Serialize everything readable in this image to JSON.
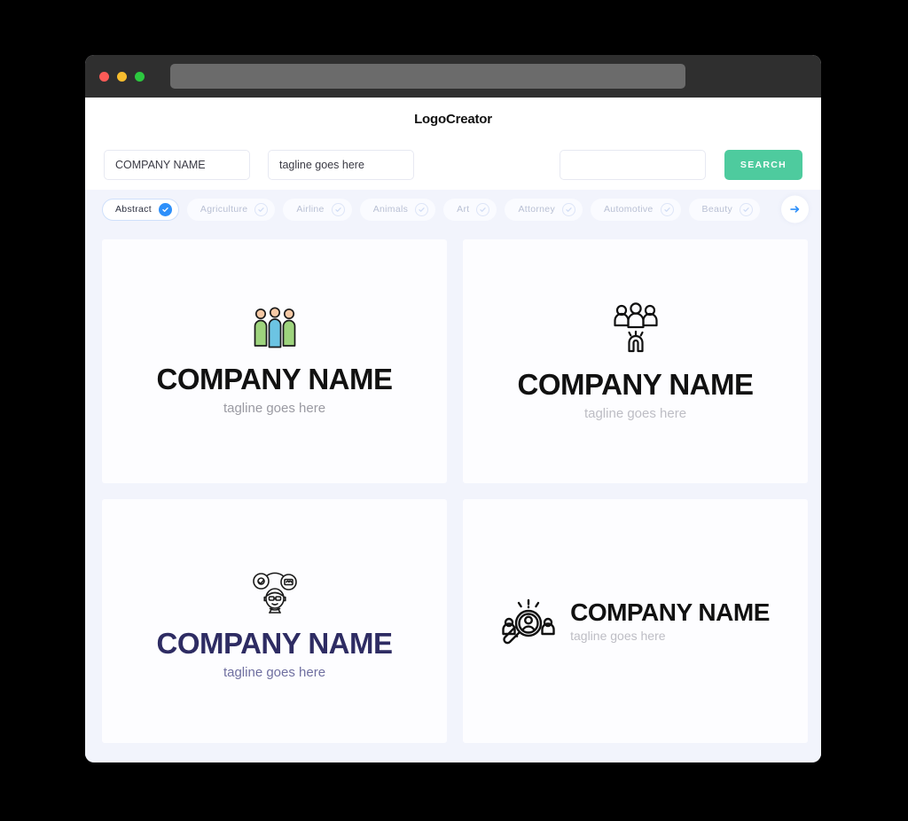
{
  "window": {
    "traffic_lights": [
      "close",
      "minimize",
      "maximize"
    ],
    "url_value": ""
  },
  "header": {
    "title": "LogoCreator"
  },
  "search": {
    "company_value": "COMPANY NAME",
    "company_placeholder": "COMPANY NAME",
    "tagline_value": "tagline goes here",
    "tagline_placeholder": "tagline goes here",
    "extra_value": "",
    "extra_placeholder": "",
    "button_label": "SEARCH"
  },
  "categories": {
    "items": [
      {
        "label": "Abstract",
        "selected": true
      },
      {
        "label": "Agriculture",
        "selected": false
      },
      {
        "label": "Airline",
        "selected": false
      },
      {
        "label": "Animals",
        "selected": false
      },
      {
        "label": "Art",
        "selected": false
      },
      {
        "label": "Attorney",
        "selected": false
      },
      {
        "label": "Automotive",
        "selected": false
      },
      {
        "label": "Beauty",
        "selected": false
      }
    ],
    "next_label": "next"
  },
  "results": {
    "cards": [
      {
        "name": "COMPANY NAME",
        "tagline": "tagline goes here",
        "icon": "three-people-icon",
        "layout": "stacked",
        "name_color": "#111111",
        "tagline_color": "#9a9aa2"
      },
      {
        "name": "COMPANY NAME",
        "tagline": "tagline goes here",
        "icon": "people-magnet-icon",
        "layout": "stacked",
        "name_color": "#111111",
        "tagline_color": "#bdbdc4"
      },
      {
        "name": "COMPANY NAME",
        "tagline": "tagline goes here",
        "icon": "support-agent-icon",
        "layout": "stacked",
        "name_color": "#2e2c63",
        "tagline_color": "#6f6fa0"
      },
      {
        "name": "COMPANY NAME",
        "tagline": "tagline goes here",
        "icon": "people-search-icon",
        "layout": "horizontal",
        "name_color": "#111111",
        "tagline_color": "#bdbdc4"
      }
    ]
  },
  "colors": {
    "accent_green": "#4ecb9e",
    "accent_blue": "#2e90fa",
    "page_bg": "#f2f4fc",
    "card_bg": "#fdfdff"
  }
}
